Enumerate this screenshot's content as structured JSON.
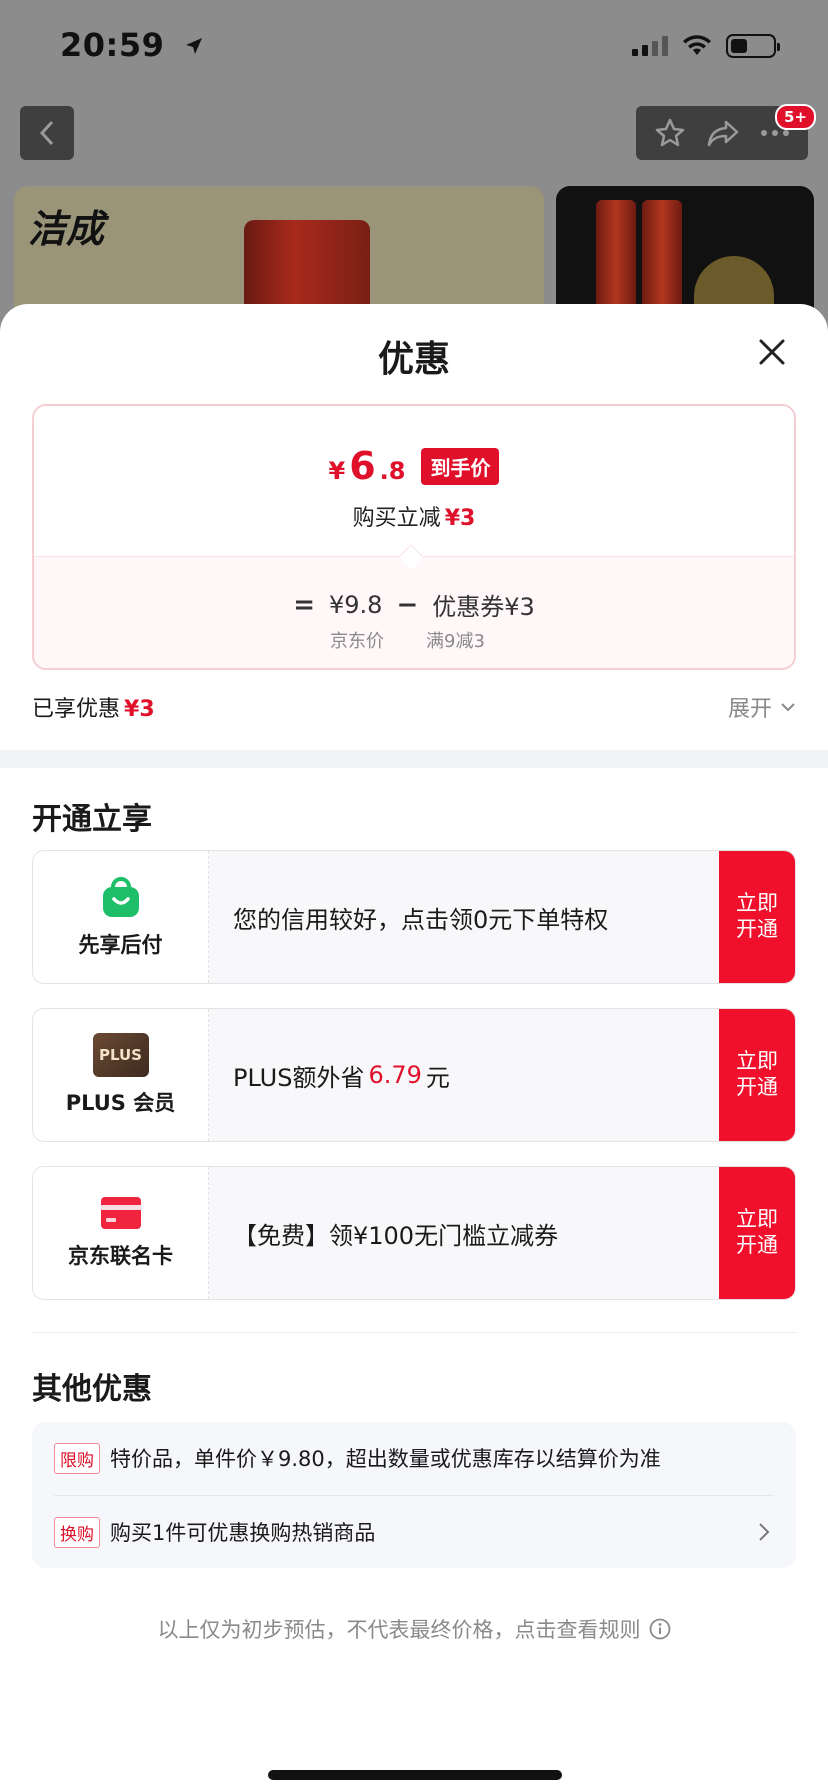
{
  "status_bar": {
    "time": "20:59"
  },
  "nav": {
    "notification_badge": "5+"
  },
  "banner": {
    "brand": "洁成"
  },
  "sheet": {
    "title": "优惠",
    "price_card": {
      "final_price_symbol": "¥",
      "final_price_int": "6",
      "final_price_dec": ".8",
      "final_price_tag": "到手价",
      "instant_reduce_label": "购买立减",
      "instant_reduce_value": "¥3",
      "calc_equal": "=",
      "jd_price": "¥9.8",
      "jd_price_label": "京东价",
      "calc_minus": "−",
      "coupon": "优惠券¥3",
      "coupon_condition": "满9减3"
    },
    "enjoyed": {
      "label": "已享优惠",
      "value": "¥3",
      "expand_label": "展开"
    },
    "open_section": {
      "title": "开通立享",
      "offers": [
        {
          "name": "先享后付",
          "text": "您的信用较好，点击领0元下单特权",
          "button": "立即开通",
          "icon": "shopping-bag-icon"
        },
        {
          "name": "PLUS 会员",
          "logo_text": "PLUS",
          "text_before": "PLUS额外省",
          "highlight": "6.79",
          "text_after": "元",
          "button": "立即开通",
          "icon": "plus-logo-icon"
        },
        {
          "name": "京东联名卡",
          "text": "【免费】领¥100无门槛立减券",
          "button": "立即开通",
          "icon": "credit-card-icon"
        }
      ]
    },
    "other_section": {
      "title": "其他优惠",
      "items": [
        {
          "tag": "限购",
          "text": "特价品，单件价￥9.80，超出数量或优惠库存以结算价为准"
        },
        {
          "tag": "换购",
          "text": "购买1件可优惠换购热销商品"
        }
      ]
    },
    "footnote": "以上仅为初步预估，不代表最终价格，点击查看规则"
  },
  "colors": {
    "accent_red": "#e0102a",
    "button_red": "#f0102c",
    "plus_brown": "#5a3e2b",
    "bag_green": "#1fbf6a"
  }
}
